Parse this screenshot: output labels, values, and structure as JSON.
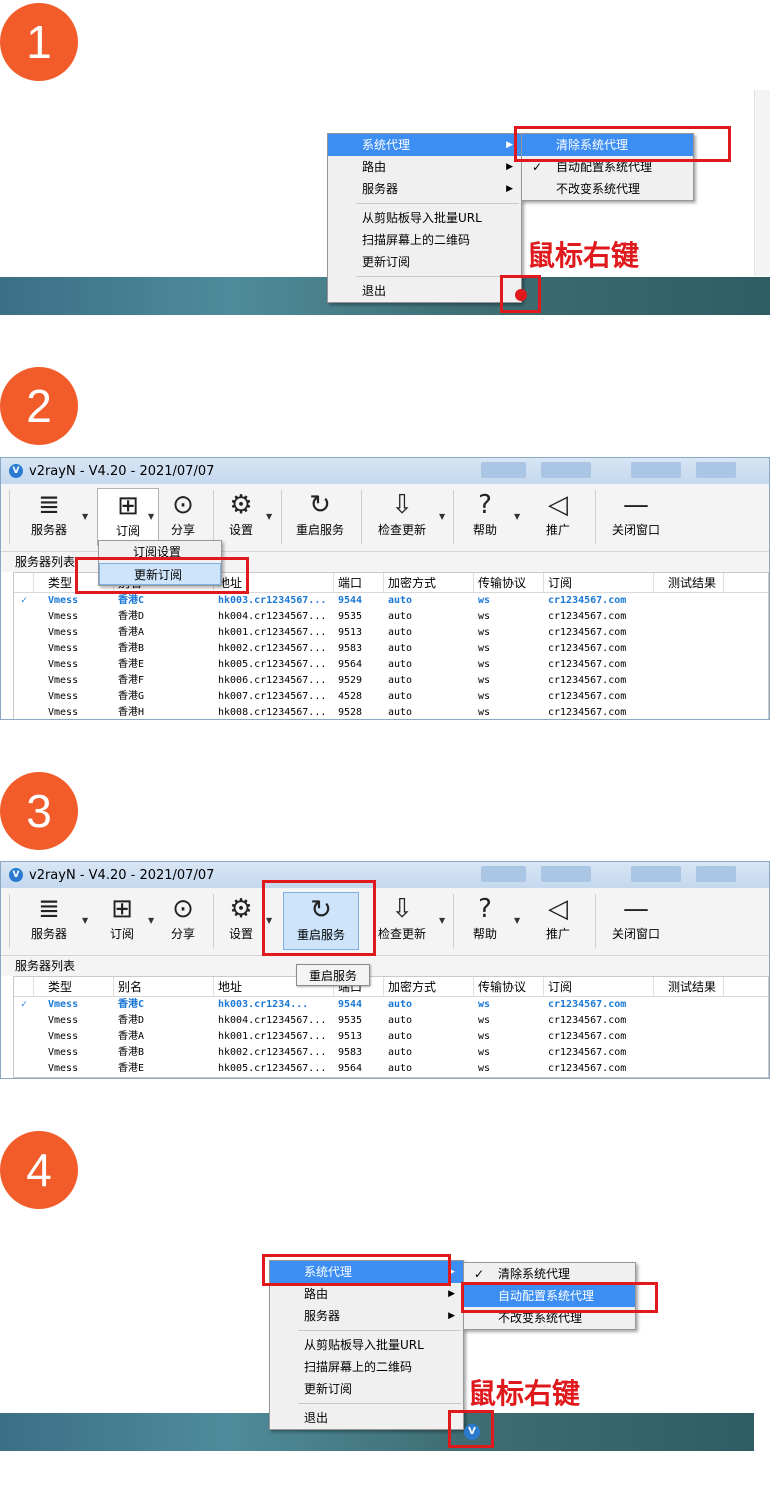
{
  "steps": [
    "1",
    "2",
    "3",
    "4"
  ],
  "tray_menu": {
    "items": [
      "系统代理",
      "路由",
      "服务器",
      "从剪贴板导入批量URL",
      "扫描屏幕上的二维码",
      "更新订阅",
      "退出"
    ],
    "submenu": [
      "清除系统代理",
      "自动配置系统代理",
      "不改变系统代理"
    ],
    "checkmark": "✓",
    "arrow": "▶"
  },
  "annotation": "鼠标右键",
  "window": {
    "title": "v2rayN - V4.20 - 2021/07/07",
    "app_icon_letter": "V",
    "toolbar": [
      "服务器",
      "订阅",
      "分享",
      "设置",
      "重启服务",
      "检查更新",
      "帮助",
      "推广",
      "关闭窗口"
    ],
    "toolbar_icons": [
      "database-icon",
      "subscribe-icon",
      "share-icon",
      "gear-icon",
      "restart-icon",
      "download-icon",
      "help-icon",
      "speaker-icon",
      "minus-icon"
    ],
    "group_label": "服务器列表",
    "subscribe_menu": [
      "订阅设置",
      "更新订阅"
    ],
    "tooltip": "重启服务",
    "columns": [
      "类型",
      "别名",
      "地址",
      "端口",
      "加密方式",
      "传输协议",
      "订阅",
      "测试结果"
    ],
    "rows": [
      {
        "check": "✓",
        "type": "Vmess",
        "alias": "香港C",
        "addr_full": "hk003.cr1234...",
        "addr": "hk003.cr1234567...",
        "port": "9544",
        "enc": "auto",
        "net": "ws",
        "sub": "cr1234567.com"
      },
      {
        "check": "",
        "type": "Vmess",
        "alias": "香港D",
        "addr": "hk004.cr1234567...",
        "port": "9535",
        "enc": "auto",
        "net": "ws",
        "sub": "cr1234567.com"
      },
      {
        "check": "",
        "type": "Vmess",
        "alias": "香港A",
        "addr": "hk001.cr1234567...",
        "port": "9513",
        "enc": "auto",
        "net": "ws",
        "sub": "cr1234567.com"
      },
      {
        "check": "",
        "type": "Vmess",
        "alias": "香港B",
        "addr": "hk002.cr1234567...",
        "port": "9583",
        "enc": "auto",
        "net": "ws",
        "sub": "cr1234567.com"
      },
      {
        "check": "",
        "type": "Vmess",
        "alias": "香港E",
        "addr": "hk005.cr1234567...",
        "port": "9564",
        "enc": "auto",
        "net": "ws",
        "sub": "cr1234567.com"
      },
      {
        "check": "",
        "type": "Vmess",
        "alias": "香港F",
        "addr": "hk006.cr1234567...",
        "port": "9529",
        "enc": "auto",
        "net": "ws",
        "sub": "cr1234567.com"
      },
      {
        "check": "",
        "type": "Vmess",
        "alias": "香港G",
        "addr": "hk007.cr1234567...",
        "port": "4528",
        "enc": "auto",
        "net": "ws",
        "sub": "cr1234567.com"
      },
      {
        "check": "",
        "type": "Vmess",
        "alias": "香港H",
        "addr": "hk008.cr1234567...",
        "port": "9528",
        "enc": "auto",
        "net": "ws",
        "sub": "cr1234567.com"
      }
    ]
  },
  "colors": {
    "accent_red": "#e0191c",
    "step_orange": "#f25c2a",
    "menu_highlight": "#3c8ef3",
    "selected_row": "#1a78d6"
  }
}
